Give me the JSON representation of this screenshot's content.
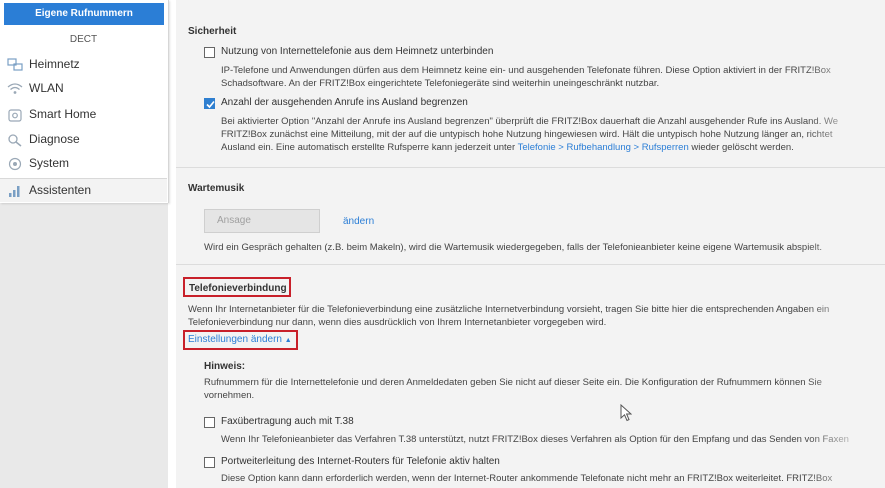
{
  "sidebar": {
    "sub_items": [
      "Eigene Rufnummern",
      "DECT"
    ],
    "items": [
      {
        "label": "Heimnetz",
        "icon": "network-icon"
      },
      {
        "label": "WLAN",
        "icon": "wifi-icon"
      },
      {
        "label": "Smart Home",
        "icon": "smart-home-icon"
      },
      {
        "label": "Diagnose",
        "icon": "diagnose-icon"
      },
      {
        "label": "System",
        "icon": "system-icon"
      },
      {
        "label": "Assistenten",
        "icon": "wizard-icon"
      }
    ]
  },
  "sicherheit": {
    "title": "Sicherheit",
    "option1": {
      "label": "Nutzung von Internettelefonie aus dem Heimnetz unterbinden",
      "checked": false,
      "desc": [
        "IP-Telefone und Anwendungen dürfen aus dem Heimnetz keine ein- und ausgehenden Telefonate führen. Diese Option aktiviert in der FRITZ!Box",
        "Schadsoftware. An der FRITZ!Box eingerichtete Telefoniegeräte sind weiterhin uneingeschränkt nutzbar."
      ]
    },
    "option2": {
      "label": "Anzahl der ausgehenden Anrufe ins Ausland begrenzen",
      "checked": true,
      "desc": [
        "Bei aktivierter Option \"Anzahl der Anrufe ins Ausland begrenzen\" überprüft die FRITZ!Box dauerhaft die Anzahl ausgehender Rufe ins Ausland. We",
        "FRITZ!Box zunächst eine Mitteilung, mit der auf die untypisch hohe Nutzung hingewiesen wird. Hält die untypisch hohe Nutzung länger an, richtet",
        "Ausland ein. Eine automatisch erstellte Rufsperre kann jederzeit unter"
      ],
      "link_text": "Telefonie > Rufbehandlung > Rufsperren",
      "desc_tail": "wieder gelöscht werden."
    }
  },
  "wartemusik": {
    "title": "Wartemusik",
    "input_placeholder": "Ansage",
    "change_link": "ändern",
    "desc": "Wird ein Gespräch gehalten (z.B. beim Makeln), wird die Wartemusik wiedergegeben, falls der Telefonieanbieter keine eigene Wartemusik abspielt."
  },
  "telefonieverbindung": {
    "title": "Telefonieverbindung",
    "desc": [
      "Wenn Ihr Internetanbieter für die Telefonieverbindung eine zusätzliche Internetverbindung vorsieht, tragen Sie bitte hier die entsprechenden Angaben ein",
      "Telefonieverbindung nur dann, wenn dies ausdrücklich von Ihrem Internetanbieter vorgegeben wird."
    ],
    "settings_link": "Einstellungen ändern",
    "hint_title": "Hinweis:",
    "hint_desc": [
      "Rufnummern für die Internettelefonie und deren Anmeldedaten geben Sie nicht auf dieser Seite ein. Die Konfiguration der Rufnummern können Sie",
      "vornehmen."
    ],
    "option_fax": {
      "label": "Faxübertragung auch mit T.38",
      "checked": false,
      "desc": "Wenn Ihr Telefonieanbieter das Verfahren T.38 unterstützt, nutzt FRITZ!Box dieses Verfahren als Option für den Empfang und das Senden von Faxen"
    },
    "option_port": {
      "label": "Portweiterleitung des Internet-Routers für Telefonie aktiv halten",
      "checked": false,
      "desc": "Diese Option kann dann erforderlich werden, wenn der Internet-Router ankommende Telefonate nicht mehr an FRITZ!Box weiterleitet. FRITZ!Box"
    }
  },
  "colors": {
    "accent": "#2b7ed6",
    "highlight_box": "#c8202a",
    "main_bg": "#f3f3f3"
  }
}
